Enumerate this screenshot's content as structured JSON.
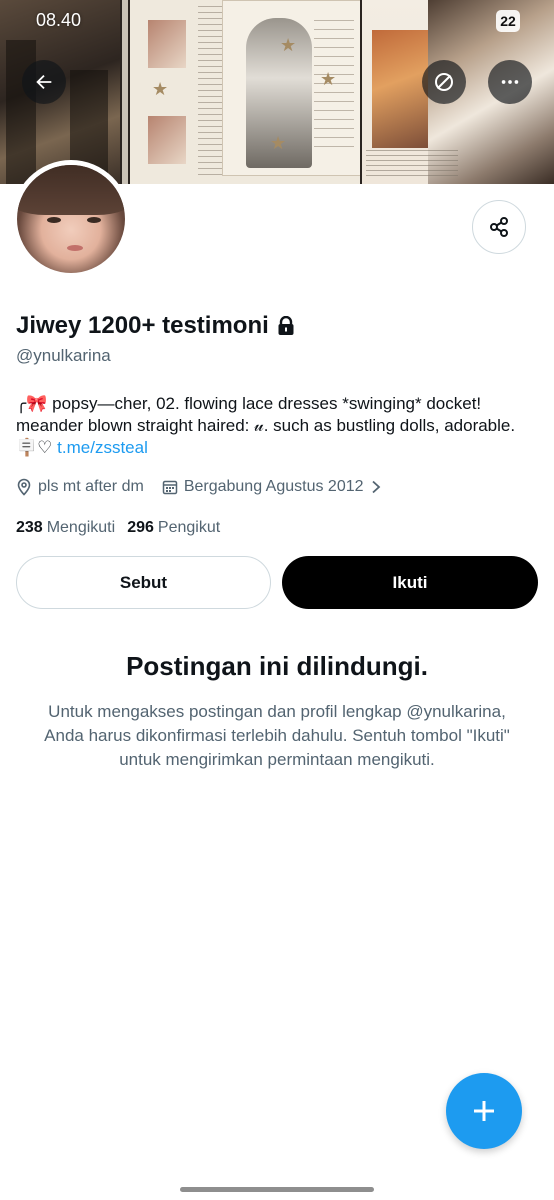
{
  "status_bar": {
    "time": "08.40",
    "battery": "22"
  },
  "header": {
    "back_icon": "arrow-left-icon",
    "block_icon": "circle-slash-icon",
    "more_icon": "more-horizontal-icon"
  },
  "profile": {
    "display_name": "Jiwey 1200+ testimoni",
    "protected_icon": "lock-icon",
    "handle": "@ynulkarina",
    "bio_text": "╭🎀 popsy—cher, 02. flowing lace dresses *swinging* docket! meander blown straight haired: 𝓊. such as bustling dolls, adorable. 🪧♡",
    "bio_link": "t.me/zssteal",
    "location": "pls mt after dm",
    "joined": "Bergabung Agustus 2012",
    "following_count": "238",
    "following_label": "Mengikuti",
    "followers_count": "296",
    "followers_label": "Pengikut"
  },
  "actions": {
    "mention_label": "Sebut",
    "follow_label": "Ikuti"
  },
  "protected_notice": {
    "title": "Postingan ini dilindungi.",
    "body": "Untuk mengakses postingan dan profil lengkap @ynulkarina, Anda harus dikonfirmasi terlebih dahulu. Sentuh tombol \"Ikuti\" untuk mengirimkan permintaan mengikuti."
  },
  "colors": {
    "accent": "#1d9bf0",
    "text_primary": "#0f1419",
    "text_secondary": "#536471",
    "follow_button": "#000000"
  }
}
